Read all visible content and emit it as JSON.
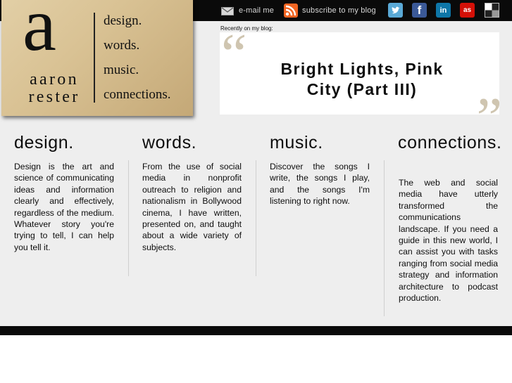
{
  "brand": {
    "letter": "a",
    "first_name": "aaron",
    "last_name": "rester",
    "tagline": [
      "design.",
      "words.",
      "music.",
      "connections."
    ]
  },
  "topnav": {
    "email_label": "e-mail me",
    "subscribe_label": "subscribe to my blog",
    "social": [
      "twitter",
      "facebook",
      "linkedin",
      "lastfm",
      "delicious"
    ]
  },
  "blog": {
    "label": "Recently on my blog:",
    "post_title": "Bright Lights, Pink City (Part III)"
  },
  "columns": [
    {
      "title": "design.",
      "text": "Design is the art and science of communicating ideas and information clearly and effectively, regardless of the medium. Whatever story you're trying to tell, I can help you tell it."
    },
    {
      "title": "words.",
      "text": "From the use of social media in nonprofit outreach to religion and nationalism in Bollywood cinema, I have written, presented on, and taught about a wide variety of subjects."
    },
    {
      "title": "music.",
      "text": "Discover the songs I write, the songs I play, and the songs I'm listening to right now."
    },
    {
      "title": "connections.",
      "text": "The web and social media have utterly transformed the communications landscape. If you need a guide in this new world, I can assist you with tasks ranging from social media strategy and information architecture to podcast production."
    }
  ],
  "colors": {
    "topbar": "#0a0a0a",
    "background": "#eeeeee",
    "paper": "#d9c294",
    "rss": "#f26522",
    "twitter": "#5aa9d6",
    "facebook": "#3b5998",
    "linkedin": "#0e76a8",
    "lastfm": "#d51007"
  }
}
